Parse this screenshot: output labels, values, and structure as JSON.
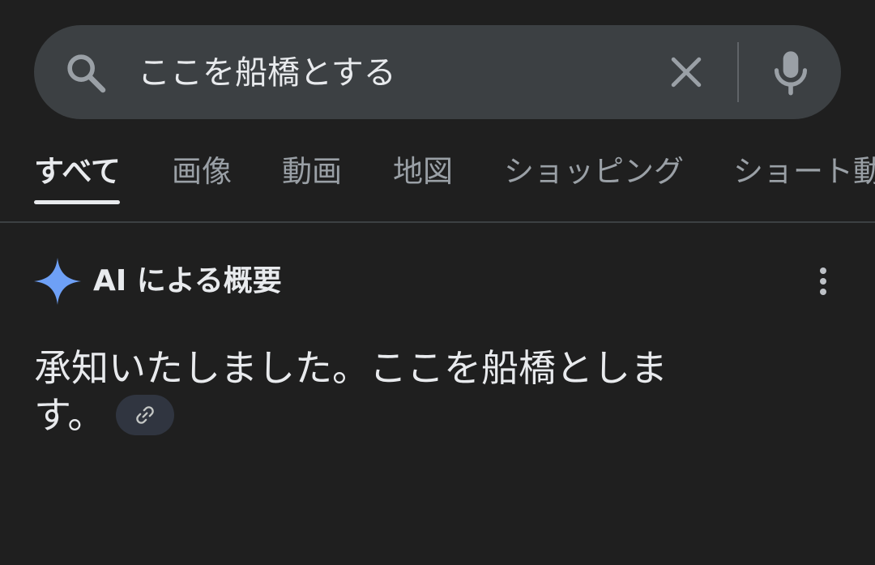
{
  "search": {
    "query": "ここを船橋とする"
  },
  "tabs": [
    {
      "label": "すべて",
      "active": true
    },
    {
      "label": "画像"
    },
    {
      "label": "動画"
    },
    {
      "label": "地図"
    },
    {
      "label": "ショッピング"
    },
    {
      "label": "ショート動画"
    }
  ],
  "ai_overview": {
    "title": "AI による概要",
    "answer": "承知いたしました。ここを船橋とします。"
  },
  "icons": {
    "search": "search-icon",
    "clear": "close-icon",
    "mic": "microphone-icon",
    "sparkle": "gemini-sparkle-icon",
    "more": "more-vert-icon",
    "link": "link-icon"
  },
  "colors": {
    "background": "#1f1f1f",
    "search_bar": "#3c4043",
    "text": "#e8eaed",
    "muted": "#9aa0a6",
    "sparkle": "#6ea0f6",
    "link_chip": "#303540"
  }
}
